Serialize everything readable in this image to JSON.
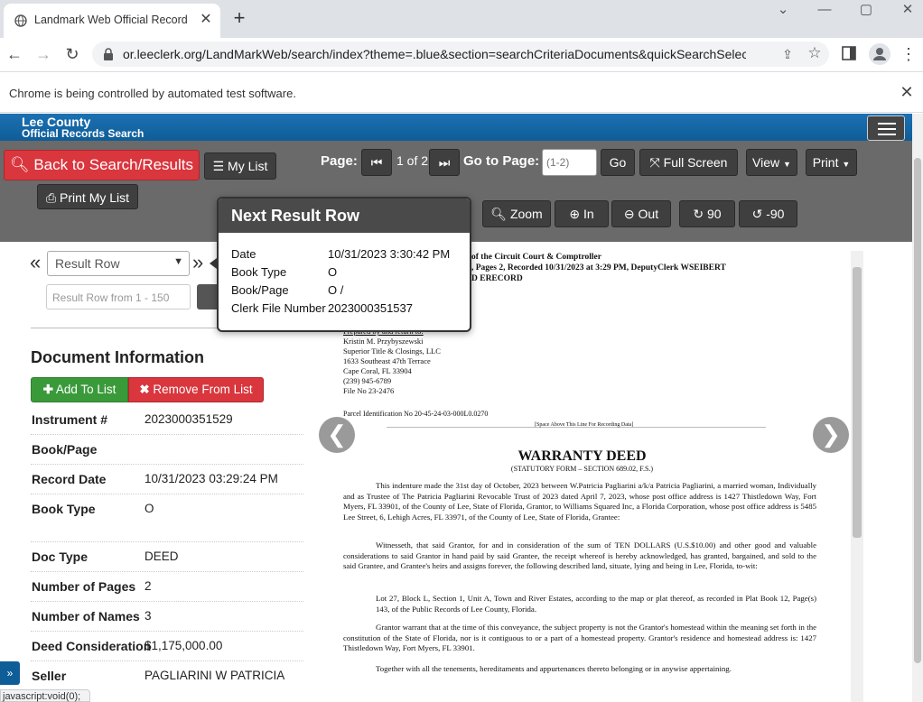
{
  "browser": {
    "tab_title": "Landmark Web Official Records",
    "url": "or.leeclerk.org/LandMarkWeb/search/index?theme=.blue&section=searchCriteriaDocuments&quickSearchSelectio...",
    "infobar_text": "Chrome is being controlled by automated test software.",
    "status_text": "javascript:void(0);"
  },
  "brand": {
    "title": "Lee County",
    "subtitle": "Official Records Search"
  },
  "toolbar": {
    "back_label": "Back to Search/Results",
    "my_list_label": "My List",
    "print_my_list_label": "Print My List",
    "page_label": "Page:",
    "page_indicator": "1 of 2",
    "goto_label": "Go to Page:",
    "goto_placeholder": "(1-2)",
    "go_label": "Go",
    "fullscreen_label": "Full Screen",
    "view_label": "View",
    "print_label": "Print",
    "zoom_label": "Zoom",
    "in_label": "In",
    "out_label": "Out",
    "rotate_cw_label": "90",
    "rotate_ccw_label": "-90"
  },
  "result_nav": {
    "prev_glyph": "«",
    "next_glyph": "»",
    "select_value": "Result Row",
    "input_placeholder": "Result Row from 1 - 150"
  },
  "doc_info": {
    "title": "Document Information",
    "add_label": "Add To List",
    "remove_label": "Remove From List",
    "rows": [
      {
        "label": "Instrument #",
        "value": "2023000351529"
      },
      {
        "label": "Book/Page",
        "value": ""
      },
      {
        "label": "Record Date",
        "value": "10/31/2023 03:29:24 PM"
      },
      {
        "label": "Book Type",
        "value": "O"
      },
      {
        "label": "Doc Type",
        "value": "DEED"
      },
      {
        "label": "Number of Pages",
        "value": "2"
      },
      {
        "label": "Number of Names",
        "value": "3"
      },
      {
        "label": "Deed Consideration",
        "value": "$1,175,000.00"
      },
      {
        "label": "Seller",
        "value": "PAGLIARINI W PATRICIA"
      }
    ]
  },
  "popover": {
    "title": "Next Result Row",
    "rows": [
      {
        "label": "Date",
        "value": "10/31/2023 3:30:42 PM"
      },
      {
        "label": "Book Type",
        "value": "O"
      },
      {
        "label": "Book/Page",
        "value": "O /"
      },
      {
        "label": "Clerk File Number",
        "value": "2023000351537"
      }
    ]
  },
  "document": {
    "header_line1": "of the Circuit Court & Comptroller",
    "header_line2": ", Pages 2, Recorded 10/31/2023 at 3:29 PM, DeputyClerk WSEIBERT",
    "header_line3": "D   ERECORD",
    "prepared_by": "Prepared by and return to:",
    "preparer_lines": [
      "Kristin M. Przybyszewski",
      "Superior Title & Closings, LLC",
      "1633 Southeast 47th Terrace",
      "Cape Coral, FL 33904",
      "(239) 945-6789",
      "File No 23-2476"
    ],
    "parcel": "Parcel Identification No 20-45-24-03-000L0.0270",
    "recording_space": "[Space Above This Line For Recording Data]",
    "deed_title": "WARRANTY DEED",
    "deed_subtitle": "(STATUTORY FORM – SECTION 689.02, F.S.)",
    "para1": "This indenture made the 31st day of October, 2023 between W.Patricia Pagliarini a/k/a Patricia Pagliarini, a married woman, Individually and as Trustee of The Patricia Pagliarini Revocable Trust of 2023 dated April 7, 2023, whose post office address is 1427 Thistledown Way, Fort Myers, FL 33901, of the County of Lee, State of Florida, Grantor, to Williams Squared Inc, a Florida Corporation, whose post office address is 5485 Lee Street, 6, Lehigh Acres, FL 33971, of the County of Lee, State of Florida, Grantee:",
    "para2": "Witnesseth, that said Grantor, for and in consideration of the sum of TEN DOLLARS (U.S.$10.00) and other good and valuable considerations to said Grantor in hand paid by said Grantee, the receipt whereof is hereby acknowledged, has granted, bargained, and sold to the said Grantee, and Grantee's heirs and assigns forever, the following described land, situate, lying and being in Lee, Florida, to-wit:",
    "para3": "Lot 27, Block L, Section 1, Unit A, Town and River Estates, according to the map or plat thereof, as recorded in Plat Book 12, Page(s) 143, of the Public Records of Lee County, Florida.",
    "para4": "Grantor warrant that at the time of this conveyance, the subject property is not the Grantor's homestead within the meaning set forth in the constitution of the State of Florida, nor is it contiguous to or a part of a homestead property. Grantor's residence and homestead address is: 1427 Thistledown Way, Fort Myers, FL 33901.",
    "para5": "Together with all the tenements, hereditaments and appurtenances thereto belonging or in anywise appertaining."
  }
}
